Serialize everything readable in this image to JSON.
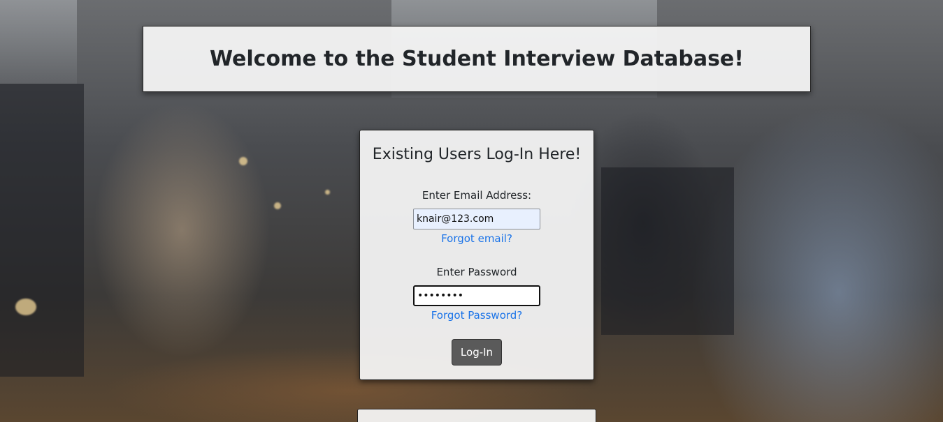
{
  "page": {
    "title": "Welcome to the Student Interview Database!"
  },
  "login": {
    "heading": "Existing Users Log-In Here!",
    "email_label": "Enter Email Address:",
    "email_value": "knair@123.com",
    "forgot_email": "Forgot email?",
    "password_label": "Enter Password",
    "password_value": "••••••••",
    "forgot_password": "Forgot Password?",
    "submit_label": "Log-In"
  },
  "colors": {
    "link": "#1a73e8",
    "button": "#5a5a5a",
    "card": "#f8f8f8"
  }
}
